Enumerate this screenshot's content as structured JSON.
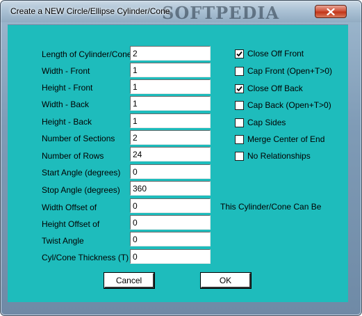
{
  "window": {
    "title": "Create a NEW Circle/Ellipse Cylinder/Cone",
    "watermark": "SOFTPEDIA"
  },
  "fields": [
    {
      "label": "Length of Cylinder/Cone",
      "value": "2"
    },
    {
      "label": "Width - Front",
      "value": "1"
    },
    {
      "label": "Height - Front",
      "value": "1"
    },
    {
      "label": "Width - Back",
      "value": "1"
    },
    {
      "label": "Height - Back",
      "value": "1"
    },
    {
      "label": "Number of Sections",
      "value": "2"
    },
    {
      "label": "Number of Rows",
      "value": "24"
    },
    {
      "label": "Start Angle (degrees)",
      "value": "0"
    },
    {
      "label": "Stop Angle (degrees)",
      "value": "360"
    },
    {
      "label": "Width Offset of",
      "value": "0"
    },
    {
      "label": "Height Offset of",
      "value": "0"
    },
    {
      "label": "Twist Angle",
      "value": "0"
    },
    {
      "label": "Cyl/Cone Thickness (T)",
      "value": "0"
    }
  ],
  "options": [
    {
      "label": "Close Off Front",
      "checked": true
    },
    {
      "label": "Cap Front (Open+T>0)",
      "checked": false
    },
    {
      "label": "Close Off Back",
      "checked": true
    },
    {
      "label": "Cap Back (Open+T>0)",
      "checked": false
    },
    {
      "label": "Cap Sides",
      "checked": false
    },
    {
      "label": "Merge Center of End",
      "checked": false
    },
    {
      "label": "No Relationships",
      "checked": false
    }
  ],
  "info_text": "This Cylinder/Cone Can Be",
  "buttons": {
    "cancel": "Cancel",
    "ok": "OK"
  },
  "colors": {
    "client_bg": "#1ebcbc",
    "close_button": "#c23418"
  }
}
